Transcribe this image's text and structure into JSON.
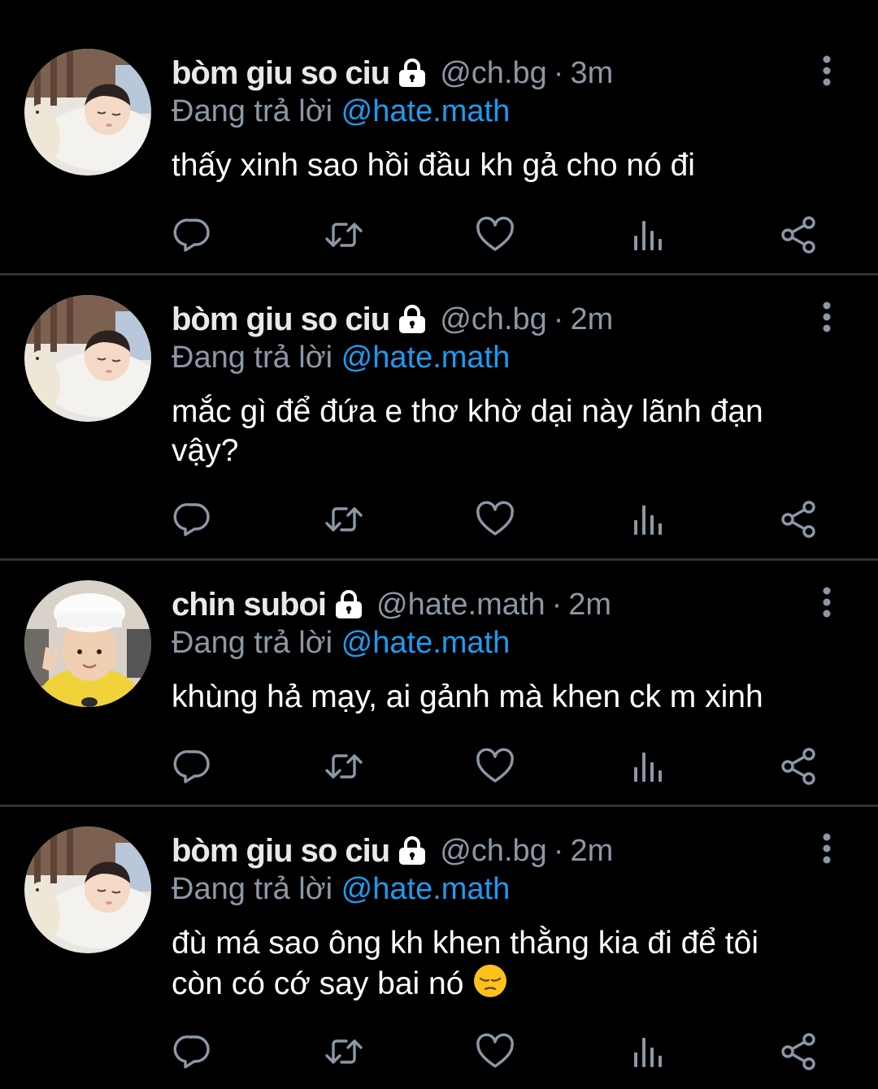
{
  "colors": {
    "background": "#000000",
    "text": "#ffffff",
    "muted": "#8b98a5",
    "mention": "#1d9bf0",
    "divider": "#2f3336"
  },
  "icons": {
    "lock": "lock-icon",
    "more": "more-vertical-icon",
    "reply": "reply-icon",
    "retweet": "retweet-icon",
    "like": "heart-icon",
    "views": "views-chart-icon",
    "share": "share-icon"
  },
  "tweets": [
    {
      "name": "bòm giu so ciu",
      "handle": "@ch.bg",
      "separator": "·",
      "time": "3m",
      "reply_prefix": "Đang trả lời",
      "reply_mention": "@hate.math",
      "text": "thấy xinh sao hồi đầu kh gả cho nó đi",
      "avatar": "sleeping-baby"
    },
    {
      "name": "bòm giu so ciu",
      "handle": "@ch.bg",
      "separator": "·",
      "time": "2m",
      "reply_prefix": "Đang trả lời",
      "reply_mention": "@hate.math",
      "text": "mắc gì để đứa e thơ khờ dại này lãnh đạn vậy?",
      "avatar": "sleeping-baby"
    },
    {
      "name": "chin suboi",
      "handle": "@hate.math",
      "separator": "·",
      "time": "2m",
      "reply_prefix": "Đang trả lời",
      "reply_mention": "@hate.math",
      "text": "khùng hả mạy, ai gảnh mà khen ck m xinh",
      "avatar": "child-white-hat"
    },
    {
      "name": "bòm giu so ciu",
      "handle": "@ch.bg",
      "separator": "·",
      "time": "2m",
      "reply_prefix": "Đang trả lời",
      "reply_mention": "@hate.math",
      "text": "đù má sao ông kh khen thằng kia đi để tôi còn có cớ say bai nó",
      "emoji": "pensive-face",
      "avatar": "sleeping-baby"
    }
  ]
}
